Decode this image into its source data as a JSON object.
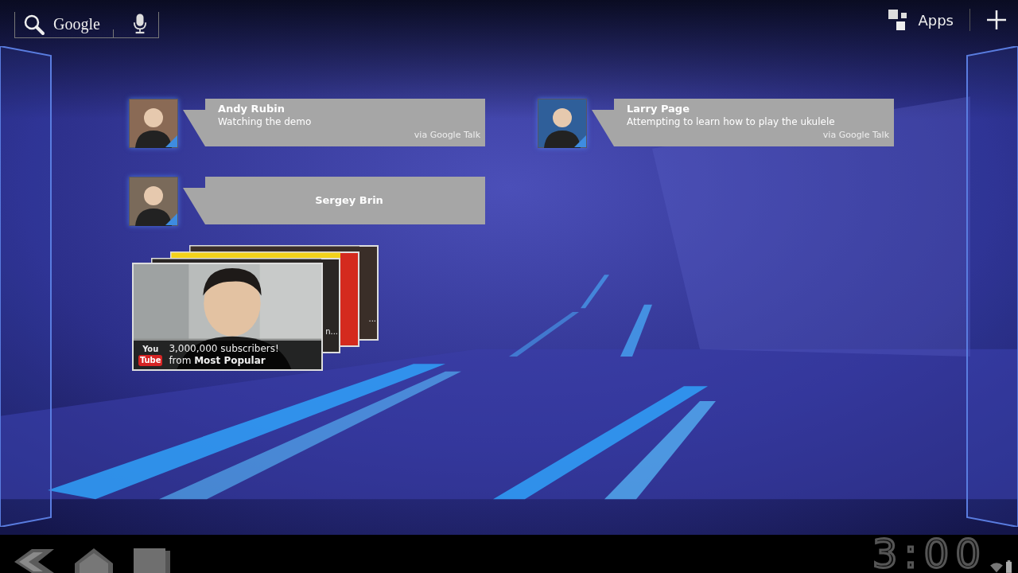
{
  "search": {
    "label": "Google"
  },
  "top_actions": {
    "apps_label": "Apps"
  },
  "contacts": [
    {
      "name": "Andy Rubin",
      "status": "Watching the demo",
      "source": "via Google Talk",
      "color": "#8a6a55"
    },
    {
      "name": "Larry Page",
      "status": "Attempting to learn how to play the ukulele",
      "source": "via Google Talk",
      "color": "#2f5f9a"
    },
    {
      "name": "Sergey Brin",
      "color": "#7a6a5a"
    }
  ],
  "youtube_widget": {
    "logo_top": "You",
    "logo_bottom": "Tube",
    "headline": "3,000,000 subscribers!",
    "source": "from **Most Popular**",
    "back_cards": [
      {
        "caption": "...",
        "color": "#3a2e28"
      },
      {
        "color": "#d42a1e"
      },
      {
        "caption": "n...",
        "color": "#2a2624"
      }
    ]
  },
  "clock": "3:00"
}
